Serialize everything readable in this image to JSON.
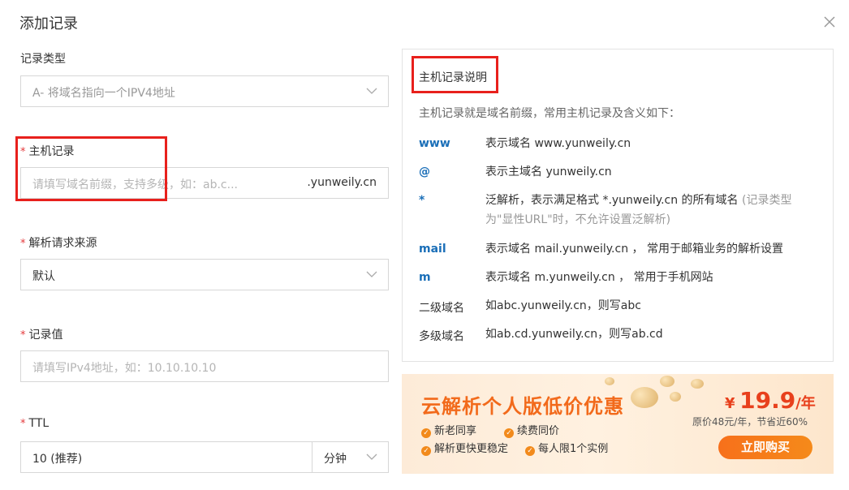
{
  "dialog": {
    "title": "添加记录"
  },
  "form": {
    "record_type": {
      "label": "记录类型",
      "value": "A- 将域名指向一个IPV4地址"
    },
    "host_record": {
      "label": "主机记录",
      "placeholder": "请填写域名前缀，支持多级，如：ab.c...",
      "suffix": ".yunweily.cn"
    },
    "resolve_source": {
      "label": "解析请求来源",
      "value": "默认"
    },
    "record_value": {
      "label": "记录值",
      "placeholder": "请填写IPv4地址，如：10.10.10.10"
    },
    "ttl": {
      "label": "TTL",
      "value": "10 (推荐)",
      "unit": "分钟"
    },
    "required_mark": "*"
  },
  "help": {
    "title": "主机记录说明",
    "intro": "主机记录就是域名前缀，常用主机记录及含义如下：",
    "rows": [
      {
        "key": "www",
        "desc": "表示域名 www.yunweily.cn",
        "note": ""
      },
      {
        "key": "@",
        "desc": "表示主域名 yunweily.cn",
        "note": ""
      },
      {
        "key": "*",
        "desc": "泛解析，表示满足格式 *.yunweily.cn 的所有域名",
        "note": "(记录类型为\"显性URL\"时，不允许设置泛解析)"
      },
      {
        "key": "mail",
        "desc": "表示域名 mail.yunweily.cn ， 常用于邮箱业务的解析设置",
        "note": ""
      },
      {
        "key": "m",
        "desc": "表示域名 m.yunweily.cn ， 常用于手机网站",
        "note": ""
      },
      {
        "key": "二级域名",
        "desc": "如abc.yunweily.cn，则写abc",
        "note": ""
      },
      {
        "key": "多级域名",
        "desc": "如ab.cd.yunweily.cn，则写ab.cd",
        "note": ""
      }
    ]
  },
  "banner": {
    "title": "云解析个人版低价优惠",
    "features": [
      "新老同享",
      "续费同价",
      "解析更快更稳定",
      "每人限1个实例"
    ],
    "check_glyph": "✓",
    "currency": "¥",
    "price": "19.9",
    "per": "/年",
    "original": "原价48元/年，节省近60%",
    "buy_label": "立即购买"
  },
  "colors": {
    "accent_blue": "#1b6fb8",
    "required_red": "#e4393c",
    "highlight_box": "#e8201c",
    "promo_orange": "#f26a1b"
  },
  "icons": {
    "close": "close-icon",
    "dropdown": "chevron-down-icon",
    "check": "check-circle-icon"
  }
}
